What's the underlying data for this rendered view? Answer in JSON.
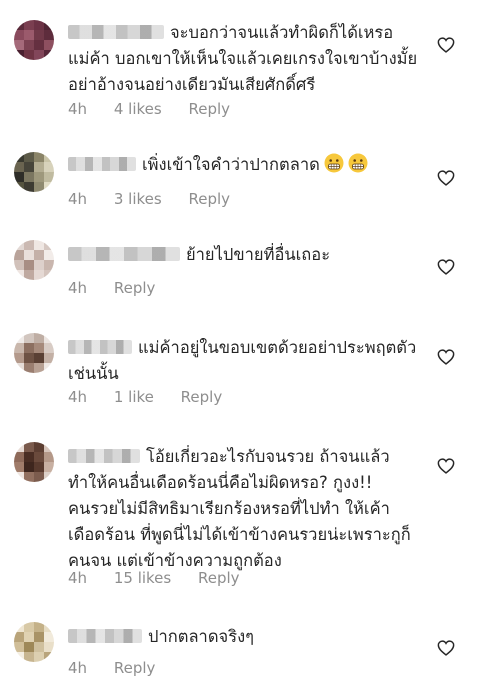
{
  "comments": [
    {
      "text": "จะบอกว่าจนแล้วทำผิดก็ได้เหรอแม่ค้า บอกเขาให้เห็นใจแล้วเคยเกรงใจเขาบ้างมั้ย อย่าอ้างจนอย่างเดียวมันเสียศักดิ์ศรี",
      "time": "4h",
      "likes": "4 likes",
      "reply": "Reply"
    },
    {
      "text": "เพิ่งเข้าใจคำว่าปากตลาด",
      "emojis": [
        "grimacing-face-emoji",
        "grimacing-face-emoji"
      ],
      "time": "4h",
      "likes": "3 likes",
      "reply": "Reply"
    },
    {
      "text": "ย้ายไปขายที่อื่นเถอะ",
      "time": "4h",
      "reply": "Reply"
    },
    {
      "text": "แม่ค้าอยู่ในขอบเขตด้วยอย่าประพฤตตัวเช่นนั้น",
      "time": "4h",
      "likes": "1 like",
      "reply": "Reply"
    },
    {
      "text": "โอ้ยเกี่ยวอะไรกับจนรวย ถ้าจนแล้วทำให้คนอื่นเดือดร้อนนี่คือไม่ผิดหรอ? กูงง!! คนรวยไม่มีสิทธิมาเรียกร้องหรอที่ไปทำ ให้เค้าเดือดร้อน ที่พูดนี่ไม่ได้เข้าข้างคนรวยน่ะเพราะกูก็คนจน แต่เข้าข้างความถูกต้อง",
      "time": "4h",
      "likes": "15 likes",
      "reply": "Reply"
    },
    {
      "text": "ปากตลาดจริงๆ",
      "time": "4h",
      "reply": "Reply"
    }
  ],
  "colors": {
    "text": "#262626",
    "meta": "#8e8e8e",
    "heart": "#262626"
  },
  "icons": {
    "like": "heart-outline-icon"
  }
}
